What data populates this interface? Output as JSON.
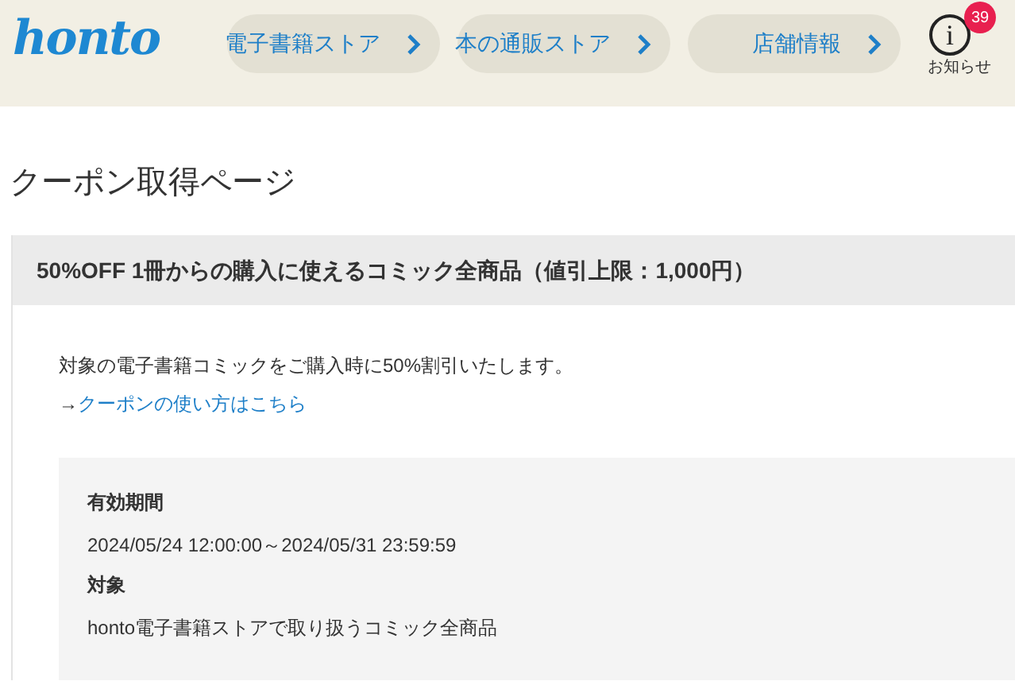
{
  "header": {
    "logo": "honto",
    "nav": [
      {
        "label": "電子書籍ストア"
      },
      {
        "label": "本の通販ストア"
      },
      {
        "label": "店舗情報"
      }
    ],
    "notice": {
      "icon_text": "i",
      "count": "39",
      "label": "お知らせ"
    }
  },
  "page_title": "クーポン取得ページ",
  "coupon": {
    "title": "50%OFF 1冊からの購入に使えるコミック全商品（値引上限：1,000円）",
    "description": "対象の電子書籍コミックをご購入時に50%割引いたします。",
    "link_prefix": "→",
    "link": "クーポンの使い方はこちら",
    "details": [
      {
        "label": "有効期間",
        "value": "2024/05/24 12:00:00～2024/05/31 23:59:59"
      },
      {
        "label": "対象",
        "value": "honto電子書籍ストアで取り扱うコミック全商品"
      }
    ]
  }
}
